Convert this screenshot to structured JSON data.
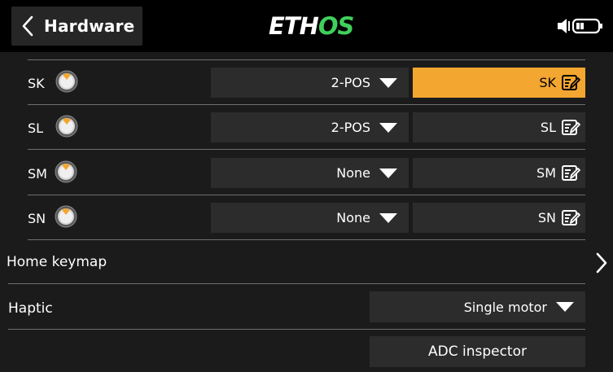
{
  "header": {
    "title": "Hardware",
    "logo_part1": "ETH",
    "logo_part2": "OS"
  },
  "switches": [
    {
      "name": "SK",
      "mode": "2-POS",
      "assign": "SK",
      "active": true
    },
    {
      "name": "SL",
      "mode": "2-POS",
      "assign": "SL",
      "active": false
    },
    {
      "name": "SM",
      "mode": "None",
      "assign": "SM",
      "active": false
    },
    {
      "name": "SN",
      "mode": "None",
      "assign": "SN",
      "active": false
    }
  ],
  "home_keymap": {
    "label": "Home keymap"
  },
  "haptic": {
    "label": "Haptic",
    "value": "Single motor"
  },
  "adc_inspector": {
    "label": "ADC inspector"
  },
  "colors": {
    "accent": "#f3a630",
    "logo_green": "#3fd05c",
    "background": "#1b1b1b",
    "field": "#2c2c2c"
  },
  "icons": {
    "back": "chevron-left-icon",
    "volume": "speaker-icon",
    "battery": "battery-icon",
    "switch": "rotary-knob-icon",
    "dropdown": "triangle-down-icon",
    "edit": "edit-icon",
    "more": "chevron-right-icon"
  }
}
